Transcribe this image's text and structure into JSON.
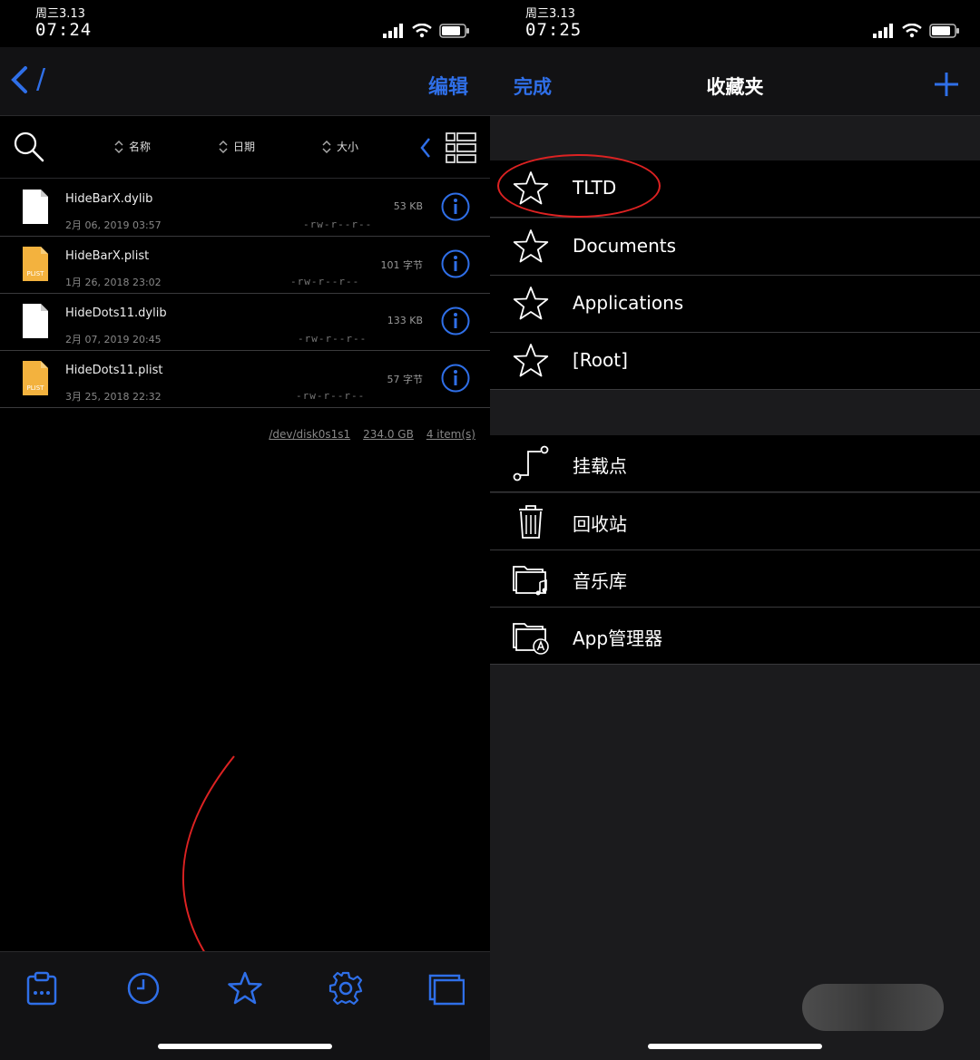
{
  "left": {
    "status": {
      "date": "周三3.13",
      "time": "07:24"
    },
    "nav": {
      "path": "/",
      "edit": "编辑"
    },
    "sort": {
      "name": "名称",
      "date": "日期",
      "size": "大小"
    },
    "files": [
      {
        "name": "HideBarX.dylib",
        "date": "2月 06, 2019 03:57",
        "size": "53 KB",
        "perm": "-rw-r--r--",
        "type": "file-icon"
      },
      {
        "name": "HideBarX.plist",
        "date": "1月 26, 2018 23:02",
        "size": "101 字节",
        "perm": "-rw-r--r--",
        "type": "plist-icon"
      },
      {
        "name": "HideDots11.dylib",
        "date": "2月 07, 2019 20:45",
        "size": "133 KB",
        "perm": "-rw-r--r--",
        "type": "file-icon"
      },
      {
        "name": "HideDots11.plist",
        "date": "3月 25, 2018 22:32",
        "size": "57 字节",
        "perm": "-rw-r--r--",
        "type": "plist-icon"
      }
    ],
    "plist_badge": "PLIST",
    "footer": {
      "disk": "/dev/disk0s1s1",
      "capacity": "234.0 GB",
      "count": "4 item(s)"
    },
    "tabs": [
      "clipboard-icon",
      "clock-icon",
      "star-icon",
      "gear-icon",
      "windows-icon"
    ]
  },
  "right": {
    "status": {
      "date": "周三3.13",
      "time": "07:25"
    },
    "nav": {
      "done": "完成",
      "title": "收藏夹"
    },
    "favorites": [
      "TLTD",
      "Documents",
      "Applications",
      "[Root]"
    ],
    "places": [
      {
        "label": "挂载点",
        "icon": "mount-point-icon"
      },
      {
        "label": "回收站",
        "icon": "trash-icon"
      },
      {
        "label": "音乐库",
        "icon": "music-folder-icon"
      },
      {
        "label": "App管理器",
        "icon": "app-folder-icon"
      }
    ]
  },
  "colors": {
    "accent": "#2f6fe8",
    "annotation": "#dd2222",
    "plist": "#f3b23e"
  }
}
